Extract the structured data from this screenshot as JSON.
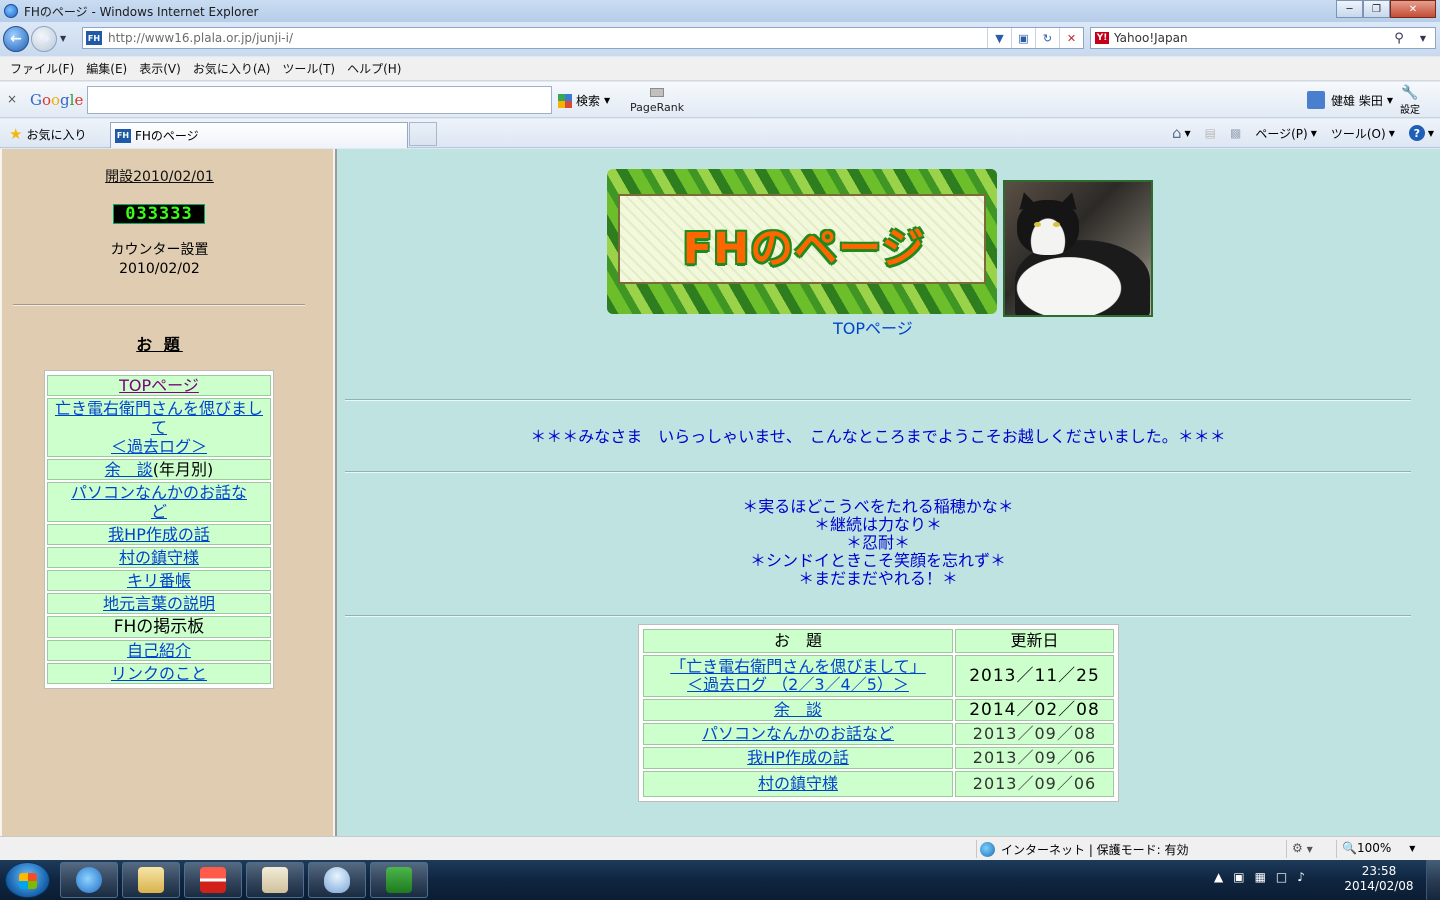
{
  "window": {
    "title": "FHのページ - Windows Internet Explorer",
    "buttons": [
      "─",
      "❐",
      "✕"
    ]
  },
  "address_bar": {
    "url": "http://www16.plala.or.jp/junji-i/",
    "favicon_text": "FH",
    "search_value": "Yahoo!Japan",
    "search_engine_icon": "Y!"
  },
  "menu": [
    "ファイル(F)",
    "編集(E)",
    "表示(V)",
    "お気に入り(A)",
    "ツール(T)",
    "ヘルプ(H)"
  ],
  "google_toolbar": {
    "close": "×",
    "logo": {
      "G": "G",
      "o1": "o",
      "o2": "o",
      "g": "g",
      "l": "l",
      "e": "e"
    },
    "search_value": "",
    "search_label": "検索",
    "pagerank_label": "PageRank",
    "user_name": "健雄 柴田",
    "settings_label": "設定"
  },
  "favorites_bar": {
    "favorites_label": "お気に入り",
    "tab_title": "FHのページ",
    "tab_favicon_text": "FH",
    "page_menu": "ページ(P)",
    "tools_menu": "ツール(O)"
  },
  "sidebar": {
    "established": "開設2010/02/01",
    "counter": "033333",
    "counter_label": "カウンター設置",
    "counter_date": "2010/02/02",
    "heading": "お 題",
    "items": [
      {
        "label": "TOPページ"
      },
      {
        "label": "亡き電右衛門さんを偲びまして",
        "label2": "＜過去ログ＞"
      },
      {
        "label": "余　談",
        "note": "(年月別)"
      },
      {
        "label": "パソコンなんかのお話な",
        "label2": "ど"
      },
      {
        "label": "我HP作成の話"
      },
      {
        "label": "村の鎮守様"
      },
      {
        "label": "キリ番帳"
      },
      {
        "label": "地元言葉の説明"
      },
      {
        "label": "FHの掲示板"
      },
      {
        "label": "自己紹介"
      },
      {
        "label": "リンクのこと"
      }
    ]
  },
  "main": {
    "banner_title": "FHのページ",
    "top_link": "TOPページ",
    "welcome": "＊＊＊みなさま　いらっしゃいませ、　こんなところまでようこそお越しくださいました。＊＊＊",
    "mottos": [
      "＊実るほどこうべをたれる稲穂かな＊",
      "＊継続は力なり＊",
      "＊忍耐＊",
      "＊シンドイときこそ笑顔を忘れず＊",
      "＊まだまだやれる！＊"
    ],
    "table": {
      "headers": [
        "お　題",
        "更新日"
      ],
      "rows": [
        {
          "title": "「亡き電右衛門さんを偲びまして」",
          "title2": "＜過去ログ （2／3／4／5）＞",
          "date": "2013／11／25"
        },
        {
          "title": "余　談",
          "date": "2014／02／08"
        },
        {
          "title": "パソコンなんかのお話など",
          "date": "2013／09／08"
        },
        {
          "title": "我HP作成の話",
          "date": "2013／09／06"
        },
        {
          "title": "村の鎮守様",
          "date": "2013／09／06"
        }
      ]
    }
  },
  "status_bar": {
    "zone": "インターネット | 保護モード: 有効",
    "zoom": "100%"
  },
  "taskbar": {
    "time": "23:58",
    "date": "2014/02/08"
  },
  "colors": {
    "sidebar_bg": "#e0cdb1",
    "main_bg": "#bfe3e1",
    "cell_bg": "#ccffcc",
    "link": "#0044cc",
    "welcome_text": "#0000cc",
    "banner_title": "#ff6600"
  }
}
